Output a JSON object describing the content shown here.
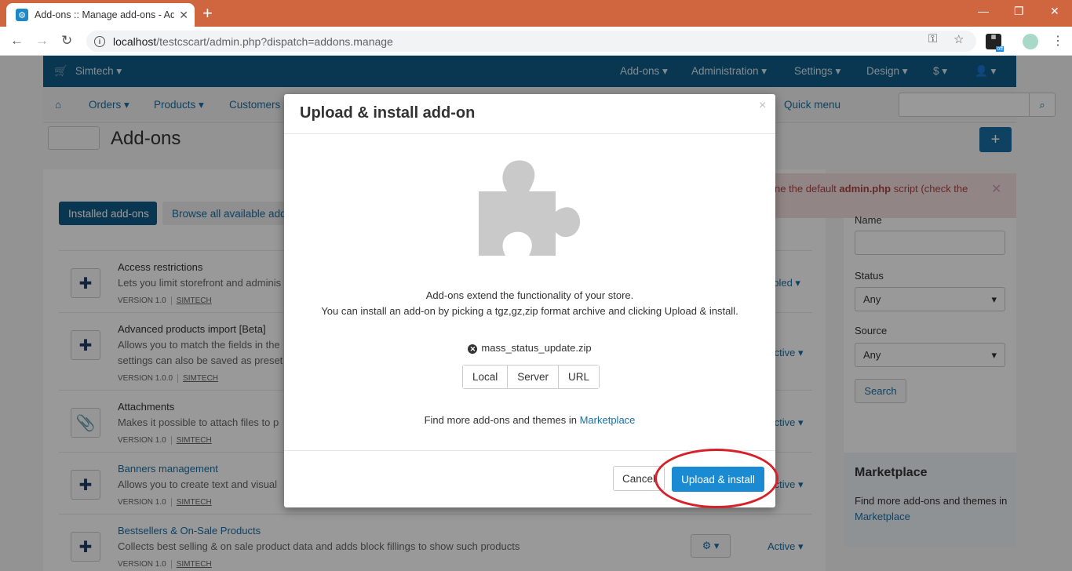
{
  "browser": {
    "tab_title": "Add-ons :: Manage add-ons - Ad",
    "url_host": "localhost",
    "url_path": "/testcscart/admin.php?dispatch=addons.manage",
    "ext_label": "off"
  },
  "topnav": {
    "brand": "Simtech ▾",
    "items": [
      "Add-ons ▾",
      "Administration ▾",
      "Settings ▾",
      "Design ▾",
      "$ ▾",
      "👤 ▾"
    ]
  },
  "subnav": {
    "items": [
      "Orders ▾",
      "Products ▾",
      "Customers"
    ],
    "quick_menu": "Quick menu"
  },
  "page": {
    "title": "Add-ons"
  },
  "tabs": {
    "installed": "Installed add-ons",
    "browse": "Browse all available add-"
  },
  "rows": [
    {
      "name": "Access restrictions",
      "desc": "Lets you limit storefront and adminis",
      "version": "VERSION 1.0",
      "vendor": "SIMTECH",
      "status": "abled ▾"
    },
    {
      "name": "Advanced products import [Beta]",
      "desc": "Allows you to match the fields in the",
      "desc2": "settings can also be saved as preset",
      "version": "VERSION 1.0.0",
      "vendor": "SIMTECH",
      "status": "Active ▾"
    },
    {
      "name": "Attachments",
      "desc": "Makes it possible to attach files to p",
      "version": "VERSION 1.0",
      "vendor": "SIMTECH",
      "status": "Active ▾"
    },
    {
      "name": "Banners management",
      "desc": "Allows you to create text and visual",
      "version": "VERSION 1.0",
      "vendor": "SIMTECH",
      "status": "Active ▾"
    },
    {
      "name": "Bestsellers & On-Sale Products",
      "desc": "Collects best selling & on sale product data and adds block fillings to show such products",
      "version": "VERSION 1.0",
      "vendor": "SIMTECH",
      "status": "Active ▾"
    }
  ],
  "alert": {
    "prefix": "ne the default ",
    "bold": "admin.php",
    "suffix": " script (check the"
  },
  "sidebar": {
    "name_label": "Name",
    "status_label": "Status",
    "status_value": "Any",
    "source_label": "Source",
    "source_value": "Any",
    "search_button": "Search"
  },
  "marketplace": {
    "title": "Marketplace",
    "text": "Find more add-ons and themes in",
    "link": "Marketplace"
  },
  "modal": {
    "title": "Upload & install add-on",
    "line1": "Add-ons extend the functionality of your store.",
    "line2": "You can install an add-on by picking a tgz,gz,zip format archive and clicking Upload & install.",
    "file_name": "mass_status_update.zip",
    "sources": [
      "Local",
      "Server",
      "URL"
    ],
    "find_text": "Find more add-ons and themes in ",
    "find_link": "Marketplace",
    "cancel": "Cancel",
    "upload": "Upload & install"
  }
}
